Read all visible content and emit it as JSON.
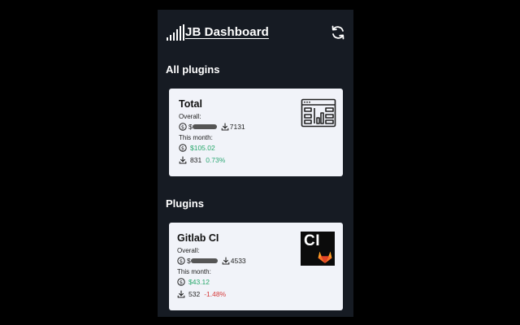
{
  "header": {
    "title": "JB Dashboard",
    "logo_icon": "bar-levels-icon",
    "refresh_icon": "refresh-icon"
  },
  "sections": {
    "all_plugins": "All plugins",
    "plugins": "Plugins"
  },
  "total_card": {
    "title": "Total",
    "overall_label": "Overall:",
    "overall_currency": "$",
    "overall_downloads": "7131",
    "month_label": "This month:",
    "month_revenue": "$105.02",
    "month_downloads": "831",
    "month_change": "0.73%",
    "icon": "dashboard-layout-icon"
  },
  "plugin_cards": [
    {
      "title": "Gitlab CI",
      "overall_label": "Overall:",
      "overall_currency": "$",
      "overall_downloads": "4533",
      "month_label": "This month:",
      "month_revenue": "$43.12",
      "month_downloads": "532",
      "month_change": "-1.48%",
      "logo_text": "CI",
      "icon": "gitlab-ci-logo-icon"
    }
  ],
  "colors": {
    "background": "#000000",
    "panel": "#161b23",
    "card": "#f1f3f9",
    "positive": "#27a86b",
    "negative": "#d63a3a"
  }
}
